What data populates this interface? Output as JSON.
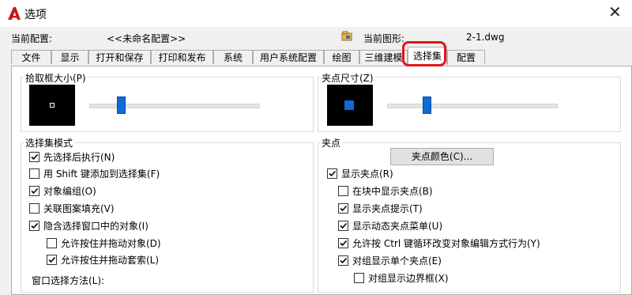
{
  "window": {
    "title": "选项",
    "close_glyph": "✕"
  },
  "config": {
    "current_profile_label": "当前配置:",
    "current_profile_value": "<<未命名配置>>",
    "current_drawing_label": "当前图形:",
    "current_drawing_value": "2-1.dwg"
  },
  "tabs": [
    {
      "label": "文件"
    },
    {
      "label": "显示"
    },
    {
      "label": "打开和保存"
    },
    {
      "label": "打印和发布"
    },
    {
      "label": "系统"
    },
    {
      "label": "用户系统配置"
    },
    {
      "label": "绘图"
    },
    {
      "label": "三维建模"
    },
    {
      "label": "选择集",
      "active": true
    },
    {
      "label": "配置"
    }
  ],
  "pickbox": {
    "title": "拾取框大小(P)",
    "level": 0.17
  },
  "grip_size": {
    "title": "夹点尺寸(Z)",
    "level": 0.22
  },
  "selection_modes": {
    "title": "选择集模式",
    "items": [
      {
        "label": "先选择后执行(N)",
        "checked": true
      },
      {
        "label": "用 Shift 键添加到选择集(F)",
        "checked": false
      },
      {
        "label": "对象编组(O)",
        "checked": true
      },
      {
        "label": "关联图案填充(V)",
        "checked": false
      },
      {
        "label": "隐含选择窗口中的对象(I)",
        "checked": true
      },
      {
        "label": "允许按住并拖动对象(D)",
        "checked": false
      },
      {
        "label": "允许按住并拖动套索(L)",
        "checked": true
      }
    ],
    "window_method_label": "窗口选择方法(L):"
  },
  "grips": {
    "title": "夹点",
    "color_button": "夹点颜色(C)...",
    "items": [
      {
        "label": "显示夹点(R)",
        "checked": true
      },
      {
        "label": "在块中显示夹点(B)",
        "checked": false
      },
      {
        "label": "显示夹点提示(T)",
        "checked": true
      },
      {
        "label": "显示动态夹点菜单(U)",
        "checked": true
      },
      {
        "label": "允许按 Ctrl 键循环改变对象编辑方式行为(Y)",
        "checked": true
      },
      {
        "label": "对组显示单个夹点(E)",
        "checked": true
      },
      {
        "label": "对组显示边界框(X)",
        "checked": false
      }
    ]
  },
  "colors": {
    "accent": "#0f6bd6",
    "highlight": "#e0161b",
    "app_red": "#c8161d"
  }
}
